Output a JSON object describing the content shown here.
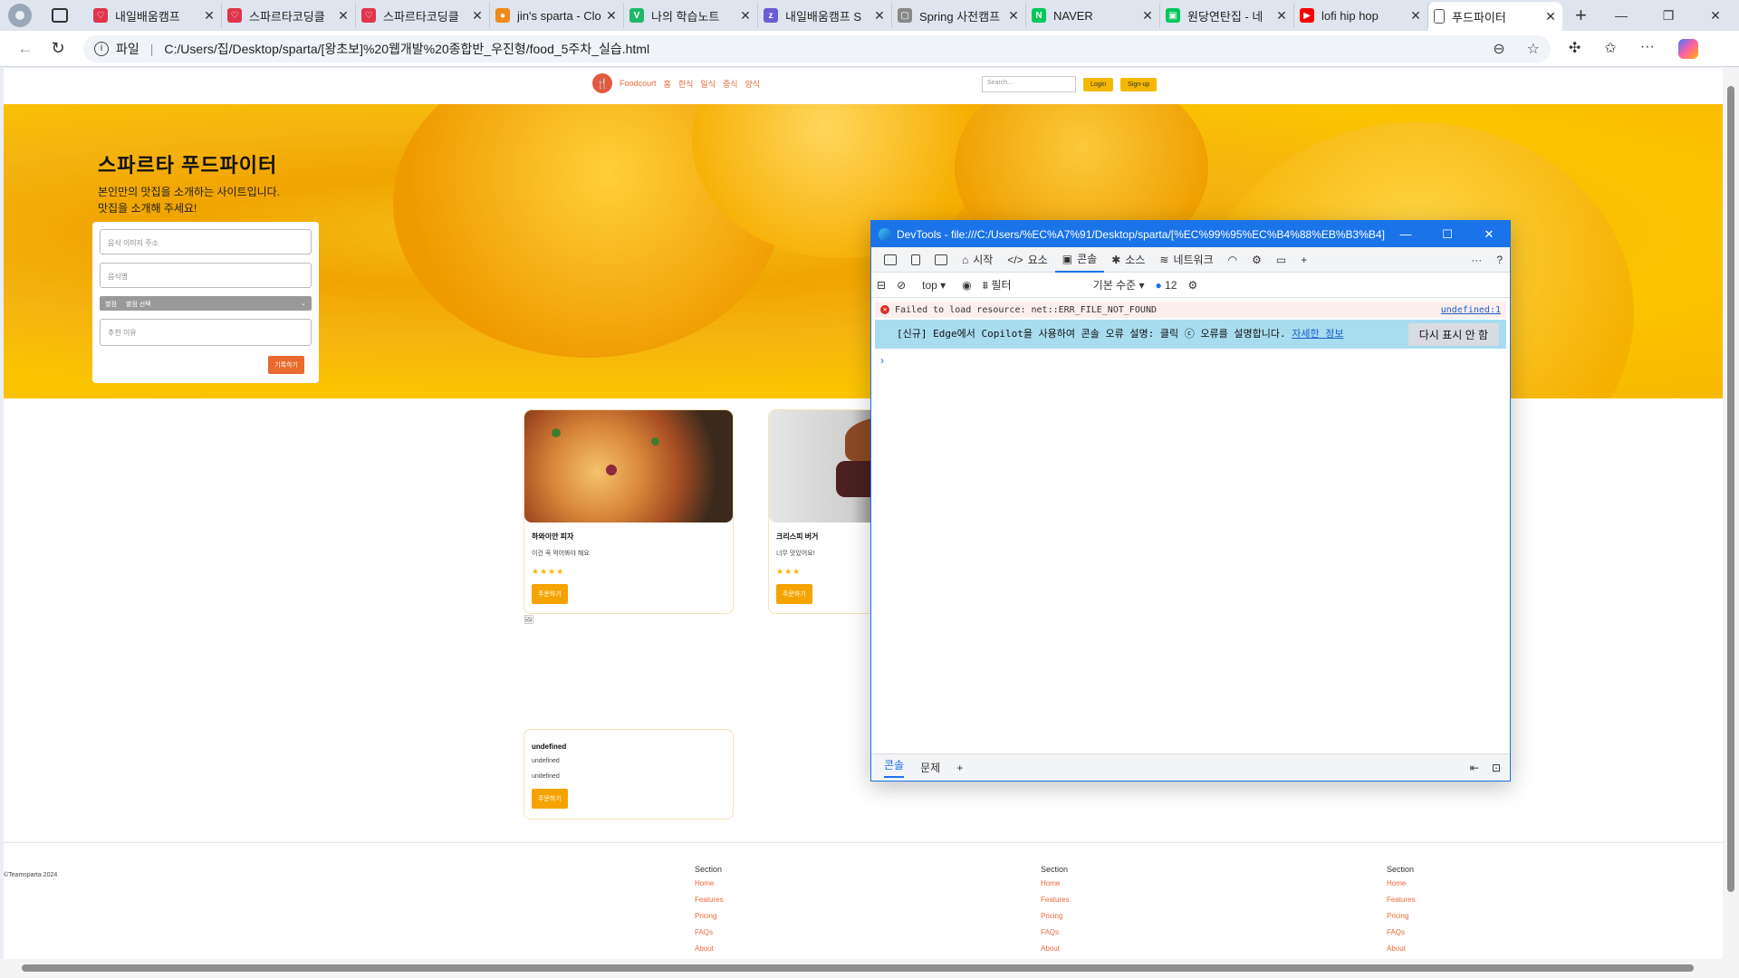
{
  "tabs": [
    {
      "title": "내일배움캠프",
      "fav_color": "#e0344b",
      "fav_glyph": "♡"
    },
    {
      "title": "스파르타코딩클",
      "fav_color": "#e0344b",
      "fav_glyph": "♡"
    },
    {
      "title": "스파르타코딩클",
      "fav_color": "#e0344b",
      "fav_glyph": "♡"
    },
    {
      "title": "jin's sparta - Clo",
      "fav_color": "#f08a1c",
      "fav_glyph": "●"
    },
    {
      "title": "나의 학습노트",
      "fav_color": "#1fb86a",
      "fav_glyph": "V"
    },
    {
      "title": "내일배움캠프 S",
      "fav_color": "#6b5bd6",
      "fav_glyph": "z"
    },
    {
      "title": "Spring 사전캠프",
      "fav_color": "#888888",
      "fav_glyph": "▢"
    },
    {
      "title": "NAVER",
      "fav_color": "#03c75a",
      "fav_glyph": "N"
    },
    {
      "title": "원당연탄집 - 네",
      "fav_color": "#03c75a",
      "fav_glyph": "▣"
    },
    {
      "title": "lofi hip hop",
      "fav_color": "#ff0000",
      "fav_glyph": "▶"
    }
  ],
  "active_tab": {
    "title": "푸드파이터"
  },
  "address": {
    "scheme_label": "파일",
    "url": "C:/Users/집/Desktop/sparta/[왕초보]%20웹개발%20종합반_우진형/food_5주차_실습.html"
  },
  "site": {
    "brand": "Foodcourt",
    "nav": [
      "홈",
      "한식",
      "일식",
      "중식",
      "양식"
    ],
    "search_placeholder": "Search...",
    "login": "Login",
    "signup": "Sign-up",
    "hero_title": "스파르타 푸드파이터",
    "hero_sub1": "본인만의 맛집을 소개하는 사이트입니다.",
    "hero_sub2": "맛집을 소개해 주세요!",
    "form": {
      "image_placeholder": "음식 이미지 주소",
      "name_placeholder": "음식명",
      "select_label": "별점",
      "select_value": "별점 선택",
      "reason_placeholder": "추천 이유",
      "submit": "기록하기"
    },
    "cards": [
      {
        "title": "하와이안 피자",
        "desc": "이건 꼭 먹어봐야 해요",
        "stars": "★★★★",
        "order": "주문하기"
      },
      {
        "title": "크리스피 버거",
        "desc": "너무 맛있어요!",
        "stars": "★★★",
        "order": "주문하기"
      },
      {
        "title": "undefined",
        "desc": "undefined",
        "stars": "undefined",
        "order": "주문하기"
      }
    ],
    "footer": {
      "copyright": "©Teamsparta 2024",
      "sections": [
        {
          "heading": "Section",
          "links": [
            "Home",
            "Features",
            "Pricing",
            "FAQs",
            "About"
          ]
        },
        {
          "heading": "Section",
          "links": [
            "Home",
            "Features",
            "Pricing",
            "FAQs",
            "About"
          ]
        },
        {
          "heading": "Section",
          "links": [
            "Home",
            "Features",
            "Pricing",
            "FAQs",
            "About"
          ]
        }
      ]
    }
  },
  "devtools": {
    "title": "DevTools - file:///C:/Users/%EC%A7%91/Desktop/sparta/[%EC%99%95%EC%B4%88%EB%B3%B4]%2...",
    "tools": [
      "시작",
      "요소",
      "콘솔",
      "소스",
      "네트워크"
    ],
    "context": "top",
    "filter_label": "필터",
    "level": "기본 수준",
    "issues_count": "12",
    "error_msg": "Failed to load resource: net::ERR_FILE_NOT_FOUND",
    "error_src": "undefined:1",
    "tip_text": "[신규] Edge에서 Copilot을 사용하여 콘솔 오류 설명: 클릭",
    "tip_text2": "오류를 설명합니다.",
    "tip_link": "자세한 정보",
    "tip_dismiss": "다시 표시 안 함",
    "drawer_tabs": [
      "콘솔",
      "문제"
    ]
  }
}
